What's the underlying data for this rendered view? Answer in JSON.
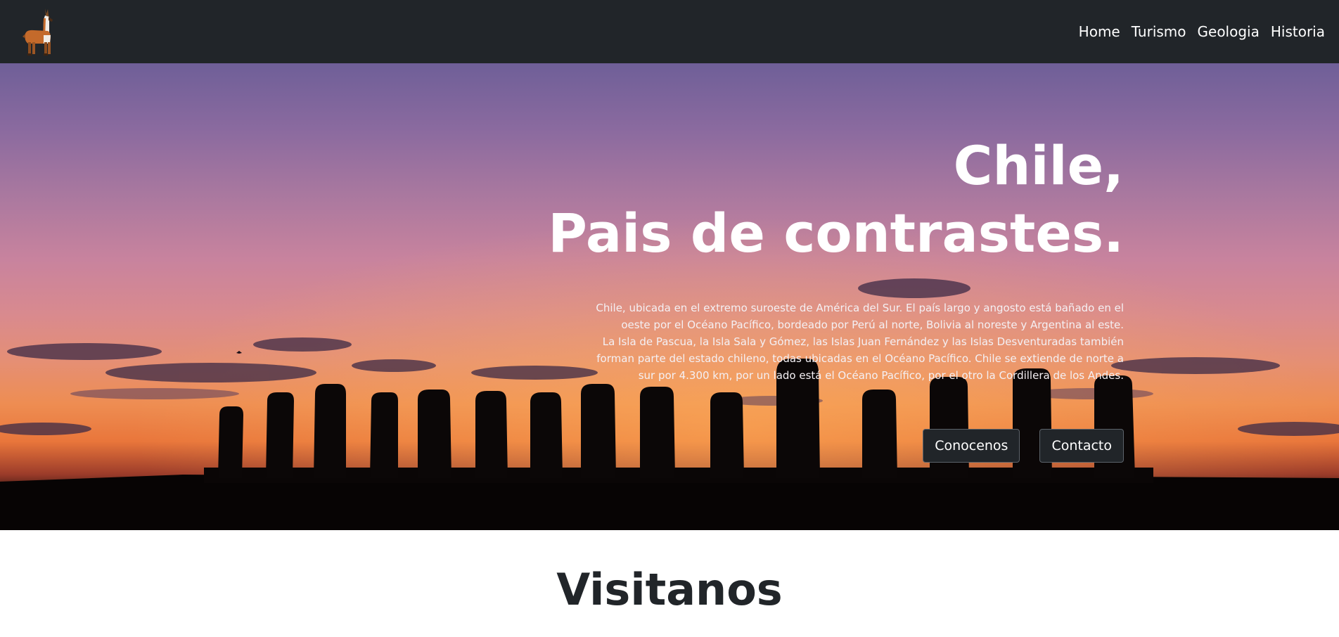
{
  "brand": {
    "logo_icon": "llama-icon"
  },
  "nav": {
    "items": [
      {
        "label": "Home"
      },
      {
        "label": "Turismo"
      },
      {
        "label": "Geologia"
      },
      {
        "label": "Historia"
      }
    ]
  },
  "hero": {
    "title_line1": "Chile,",
    "title_line2": "Pais de contrastes.",
    "description_lines": [
      "Chile, ubicada en el extremo suroeste de América del Sur. El país largo y angosto está bañado en el",
      "oeste por el Océano Pacífico, bordeado por Perú al norte, Bolivia al noreste y Argentina al este.",
      "La Isla de Pascua, la Isla Sala y Gómez, las Islas Juan Fernández y las Islas Desventuradas también",
      "forman parte del estado chileno, todas ubicadas en el Océano Pacífico. Chile se extiende de norte a",
      "sur por 4.300 km, por un lado está el Océano Pacífico, por el otro la Cordillera de los Andes."
    ],
    "buttons": {
      "primary": "Conocenos",
      "secondary": "Contacto"
    }
  },
  "section": {
    "title": "Visitanos"
  },
  "colors": {
    "navbar": "#212529",
    "button": "#212529",
    "heading": "#212529"
  }
}
